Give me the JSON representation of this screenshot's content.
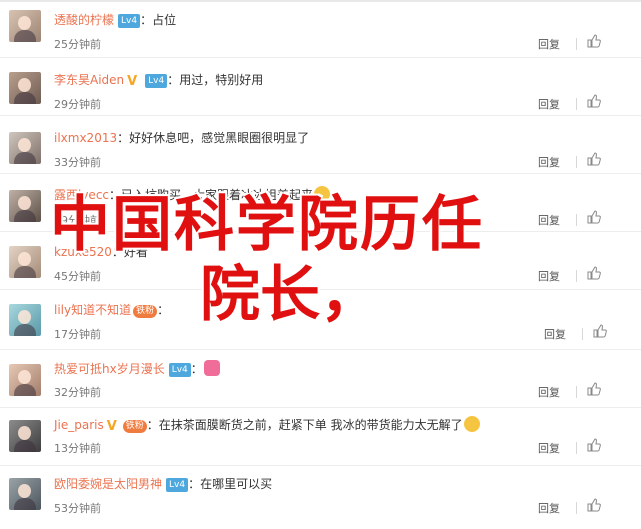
{
  "overlay": {
    "line1": "中国科学院历任",
    "line2": "院长，"
  },
  "ui": {
    "reply_label": "回复"
  },
  "comments": [
    {
      "user": "透酸的柠檬",
      "badges": [
        "vip"
      ],
      "vip_label": "Lv4",
      "text": "占位",
      "time": "25分钟前"
    },
    {
      "user": "李东昊Aiden",
      "badges": [
        "v",
        "vip"
      ],
      "vip_label": "Lv4",
      "text": "用过，特别好用",
      "time": "29分钟前"
    },
    {
      "user": "ilxmx2013",
      "badges": [],
      "text": "好好休息吧，感觉黑眼圈很明显了",
      "time": "33分钟前"
    },
    {
      "user": "露西lvecc",
      "badges": [],
      "text": "已入坑购买，大家跟着冰冰姐美起来",
      "time": "39分钟前"
    },
    {
      "user": "kzuxe520",
      "badges": [],
      "text": "好看",
      "time": "45分钟前"
    },
    {
      "user": "lily知道不知道",
      "badges": [
        "fan"
      ],
      "fan_label": "铁粉",
      "text": "",
      "time": "17分钟前"
    },
    {
      "user": "热爱可抵hx岁月漫长",
      "badges": [
        "vip"
      ],
      "vip_label": "Lv4",
      "text": "",
      "time": "32分钟前"
    },
    {
      "user": "Jie_paris",
      "badges": [
        "v",
        "fan"
      ],
      "fan_label": "铁粉",
      "text": "在抹茶面膜断货之前，赶紧下单 我冰的带货能力太无解了",
      "time": "13分钟前"
    },
    {
      "user": "欧阳委婉是太阳男神",
      "badges": [
        "vip"
      ],
      "vip_label": "Lv4",
      "text": "在哪里可以买",
      "time": "53分钟前"
    }
  ]
}
